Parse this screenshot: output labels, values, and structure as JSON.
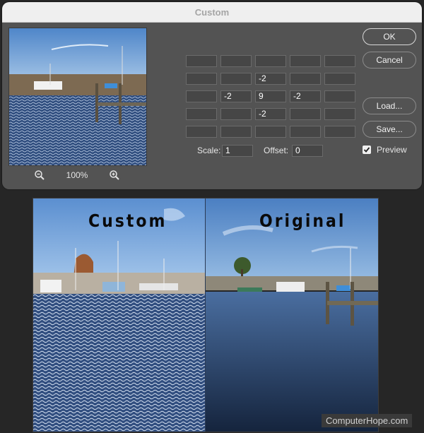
{
  "dialog": {
    "title": "Custom",
    "zoom_level": "100%",
    "matrix": [
      [
        "",
        "",
        "",
        "",
        ""
      ],
      [
        "",
        "",
        "-2",
        "",
        ""
      ],
      [
        "",
        "-2",
        "9",
        "-2",
        ""
      ],
      [
        "",
        "",
        "-2",
        "",
        ""
      ],
      [
        "",
        "",
        "",
        "",
        ""
      ]
    ],
    "scale_label": "Scale:",
    "scale_value": "1",
    "offset_label": "Offset:",
    "offset_value": "0",
    "buttons": {
      "ok": "OK",
      "cancel": "Cancel",
      "load": "Load...",
      "save": "Save..."
    },
    "preview_label": "Preview",
    "preview_checked": true
  },
  "comparison": {
    "left_label": "Custom",
    "right_label": "Original"
  },
  "watermark": "ComputerHope.com",
  "colors": {
    "dialog_bg": "#535353",
    "sky": "#6c9ad6",
    "water": "#2b4470"
  }
}
